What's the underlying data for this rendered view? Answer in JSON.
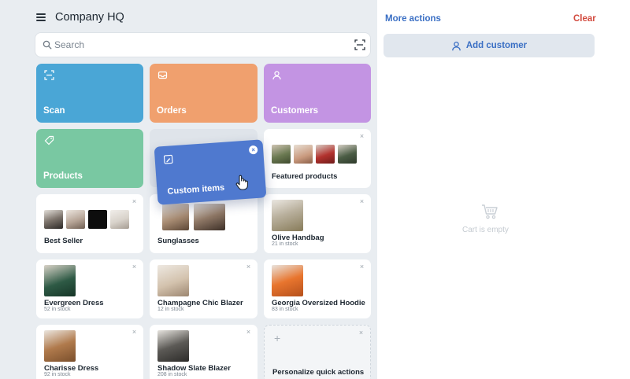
{
  "app": {
    "title": "Company HQ"
  },
  "search": {
    "placeholder": "Search"
  },
  "quick_actions": {
    "scan": {
      "label": "Scan",
      "color": "#4aa6d6"
    },
    "orders": {
      "label": "Orders",
      "color": "#f0a06e"
    },
    "customers": {
      "label": "Customers",
      "color": "#c394e3"
    },
    "products": {
      "label": "Products",
      "color": "#79c8a2"
    },
    "custom_items": {
      "label": "Custom items",
      "color": "#4f79cf"
    }
  },
  "collections": {
    "featured": {
      "name": "Featured products"
    },
    "best_seller": {
      "name": "Best Seller"
    },
    "sunglasses": {
      "name": "Sunglasses"
    }
  },
  "products": [
    {
      "name": "Olive Handbag",
      "stock": "21 in stock"
    },
    {
      "name": "Evergreen Dress",
      "stock": "52 in stock"
    },
    {
      "name": "Champagne Chic Blazer",
      "stock": "12 in stock"
    },
    {
      "name": "Georgia Oversized Hoodie",
      "stock": "83 in stock"
    },
    {
      "name": "Charisse Dress",
      "stock": "92 in stock"
    },
    {
      "name": "Shadow Slate Blazer",
      "stock": "208 in stock"
    }
  ],
  "personalize": {
    "label": "Personalize quick actions"
  },
  "cart": {
    "more_actions": "More actions",
    "clear": "Clear",
    "add_customer": "Add customer",
    "empty_text": "Cart is empty"
  }
}
